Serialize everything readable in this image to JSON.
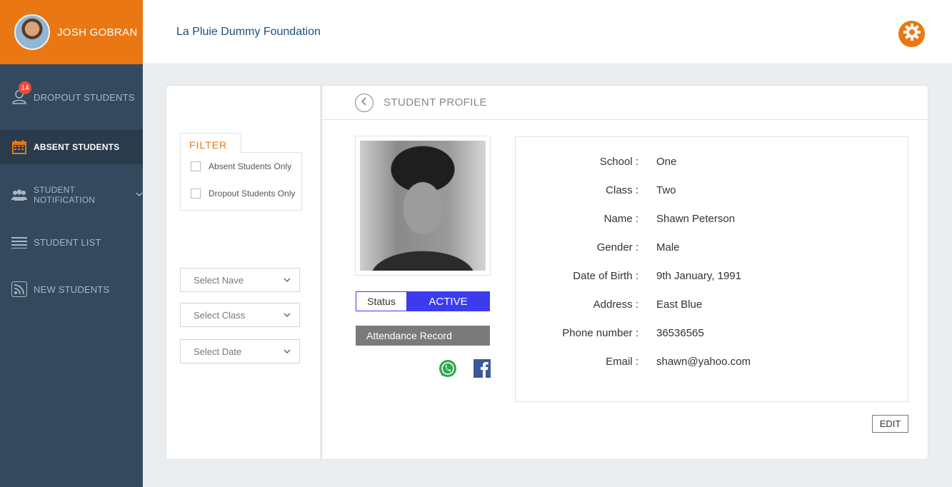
{
  "user": {
    "name": "JOSH GOBRAN"
  },
  "sidebar": {
    "items": [
      {
        "label": "DROPOUT STUDENTS",
        "badge": "14"
      },
      {
        "label": "ABSENT STUDENTS"
      },
      {
        "label": "STUDENT NOTIFICATION"
      },
      {
        "label": "STUDENT LIST"
      },
      {
        "label": "NEW STUDENTS"
      }
    ]
  },
  "header": {
    "org_name": "La Pluie Dummy Foundation"
  },
  "filter": {
    "tab_label": "FILTER",
    "checks": [
      {
        "label": "Absent Students Only"
      },
      {
        "label": "Dropout Students Only"
      }
    ],
    "selects": [
      {
        "value": "Select Nave"
      },
      {
        "value": "Select Class"
      },
      {
        "value": "Select Date"
      }
    ]
  },
  "profile": {
    "title": "STUDENT PROFILE",
    "status_label": "Status",
    "status_value": "ACTIVE",
    "attendance_label": "Attendance Record",
    "details": [
      {
        "key": "School :",
        "value": "One"
      },
      {
        "key": "Class :",
        "value": "Two"
      },
      {
        "key": "Name :",
        "value": "Shawn Peterson"
      },
      {
        "key": "Gender :",
        "value": "Male"
      },
      {
        "key": "Date of Birth :",
        "value": "9th January, 1991"
      },
      {
        "key": "Address :",
        "value": "East Blue"
      },
      {
        "key": "Phone number :",
        "value": "36536565"
      },
      {
        "key": "Email :",
        "value": "shawn@yahoo.com"
      }
    ],
    "edit_label": "EDIT"
  },
  "colors": {
    "accent": "#e97814",
    "sidebar": "#34495e",
    "status_active": "#3b3bf0"
  }
}
